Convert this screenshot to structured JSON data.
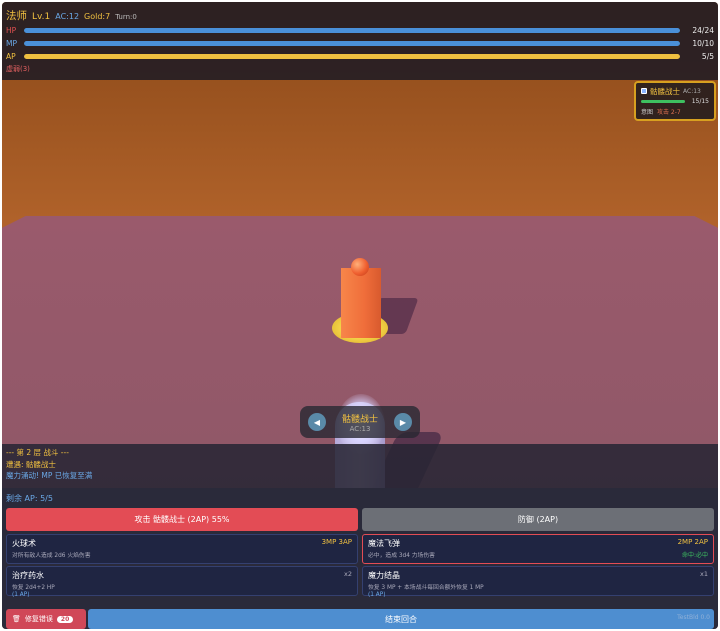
{
  "hud": {
    "class_name": "法师",
    "level": "Lv.1",
    "ac": "AC:12",
    "gold": "Gold:7",
    "turn": "Turn:0",
    "bars": [
      {
        "label": "HP",
        "value": "24/24",
        "fraction": 1.0,
        "color": "#4a90d9",
        "label_color": "#e05050"
      },
      {
        "label": "MP",
        "value": "10/10",
        "fraction": 1.0,
        "color": "#4a90d9",
        "label_color": "#6aa8e6"
      },
      {
        "label": "AP",
        "value": "5/5",
        "fraction": 1.0,
        "color": "#f0c040",
        "label_color": "#f0c040"
      }
    ],
    "status": "虚弱(3)"
  },
  "target": {
    "name": "骷髅战士",
    "ac": "AC:13",
    "hp": "15/15",
    "hp_fraction": 1.0,
    "intent_label": "意图",
    "intent_value": "攻击 2-7"
  },
  "selector": {
    "prev_icon": "◀",
    "next_icon": "▶",
    "name": "骷髅战士",
    "ac": "AC:13"
  },
  "log": [
    "--- 第 2 层 战斗 ---",
    "遭遇: 骷髅战士",
    "魔力涌动! MP 已恢复至满"
  ],
  "actions": {
    "ap_remaining": "剩余 AP: 5/5",
    "attack": "攻击 骷髅战士 (2AP) 55%",
    "defend": "防御 (2AP)"
  },
  "cards": {
    "fireball": {
      "name": "火球术",
      "cost": "3MP 3AP",
      "desc": "对所有敌人造成 2d6 火焰伤害"
    },
    "missile": {
      "name": "魔法飞弹",
      "cost": "2MP 2AP",
      "desc": "必中，造成 3d4 力场伤害",
      "tag": "命中:必中"
    },
    "potion": {
      "name": "治疗药水",
      "count": "x2",
      "desc": "恢复 2d4+2 HP",
      "ap": "(1 AP)"
    },
    "crystal": {
      "name": "魔力结晶",
      "count": "x1",
      "desc": "恢复 3 MP + 本场战斗每回合额外恢复 1 MP",
      "ap": "(1 AP)"
    }
  },
  "bottom": {
    "repair_label": "修复错误",
    "repair_icon": "trash-icon",
    "repair_count": "20",
    "end_turn": "结束回合",
    "version": "TestBld 0.0"
  },
  "colors": {
    "accent_gold": "#f0c040",
    "mana_blue": "#6aa8e6",
    "danger_red": "#e34c55",
    "end_turn_blue": "#4e8ed0"
  }
}
